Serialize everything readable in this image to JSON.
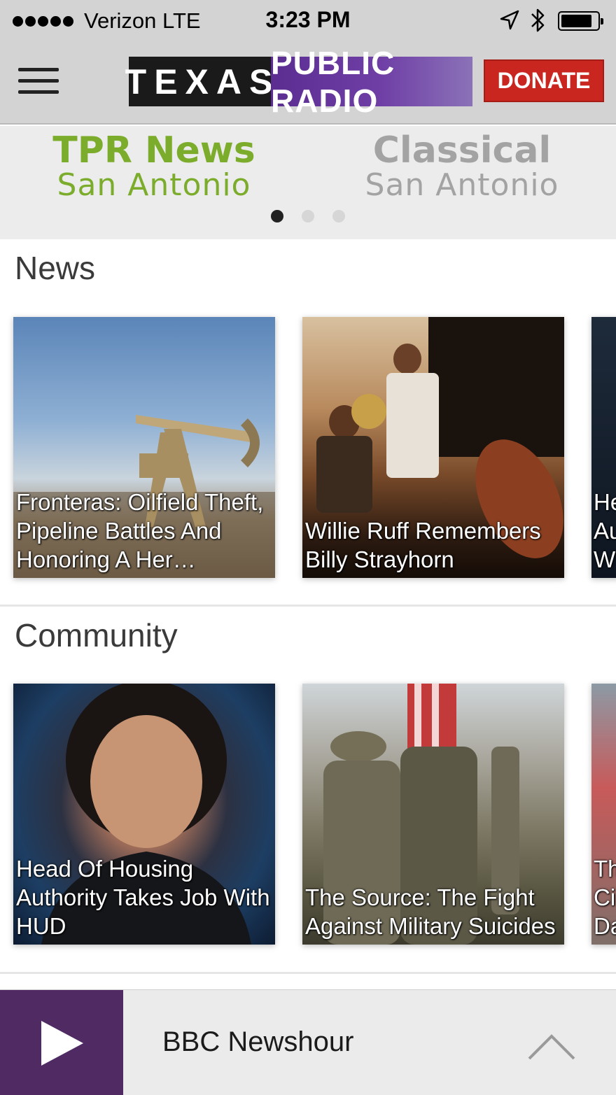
{
  "status_bar": {
    "carrier": "Verizon  LTE",
    "time": "3:23 PM"
  },
  "header": {
    "logo_left": "TEXAS",
    "logo_right": "PUBLIC RADIO",
    "donate_label": "DONATE",
    "menu_icon": "hamburger-icon"
  },
  "stations": [
    {
      "name": "TPR News",
      "city": "San  Antonio"
    },
    {
      "name": "Classical",
      "city": "San  Antonio"
    }
  ],
  "sections": [
    {
      "title": "News",
      "cards": [
        {
          "caption": "Fronteras: Oilfield Theft, Pipeline Battles And Honoring A Her…"
        },
        {
          "caption": "Willie Ruff Remembers Billy Strayhorn"
        },
        {
          "caption": "He Au W"
        }
      ]
    },
    {
      "title": "Community",
      "cards": [
        {
          "caption": "Head Of Housing Authority Takes Job With HUD"
        },
        {
          "caption": "The Source: The Fight Against Military Suicides"
        },
        {
          "caption": "Th Ci Da"
        }
      ]
    }
  ],
  "player": {
    "now_playing": "BBC Newshour",
    "accent_color": "#4f2a63"
  },
  "colors": {
    "active_station": "#7cac2b",
    "inactive_station": "#a3a3a3",
    "donate": "#c9261f"
  }
}
